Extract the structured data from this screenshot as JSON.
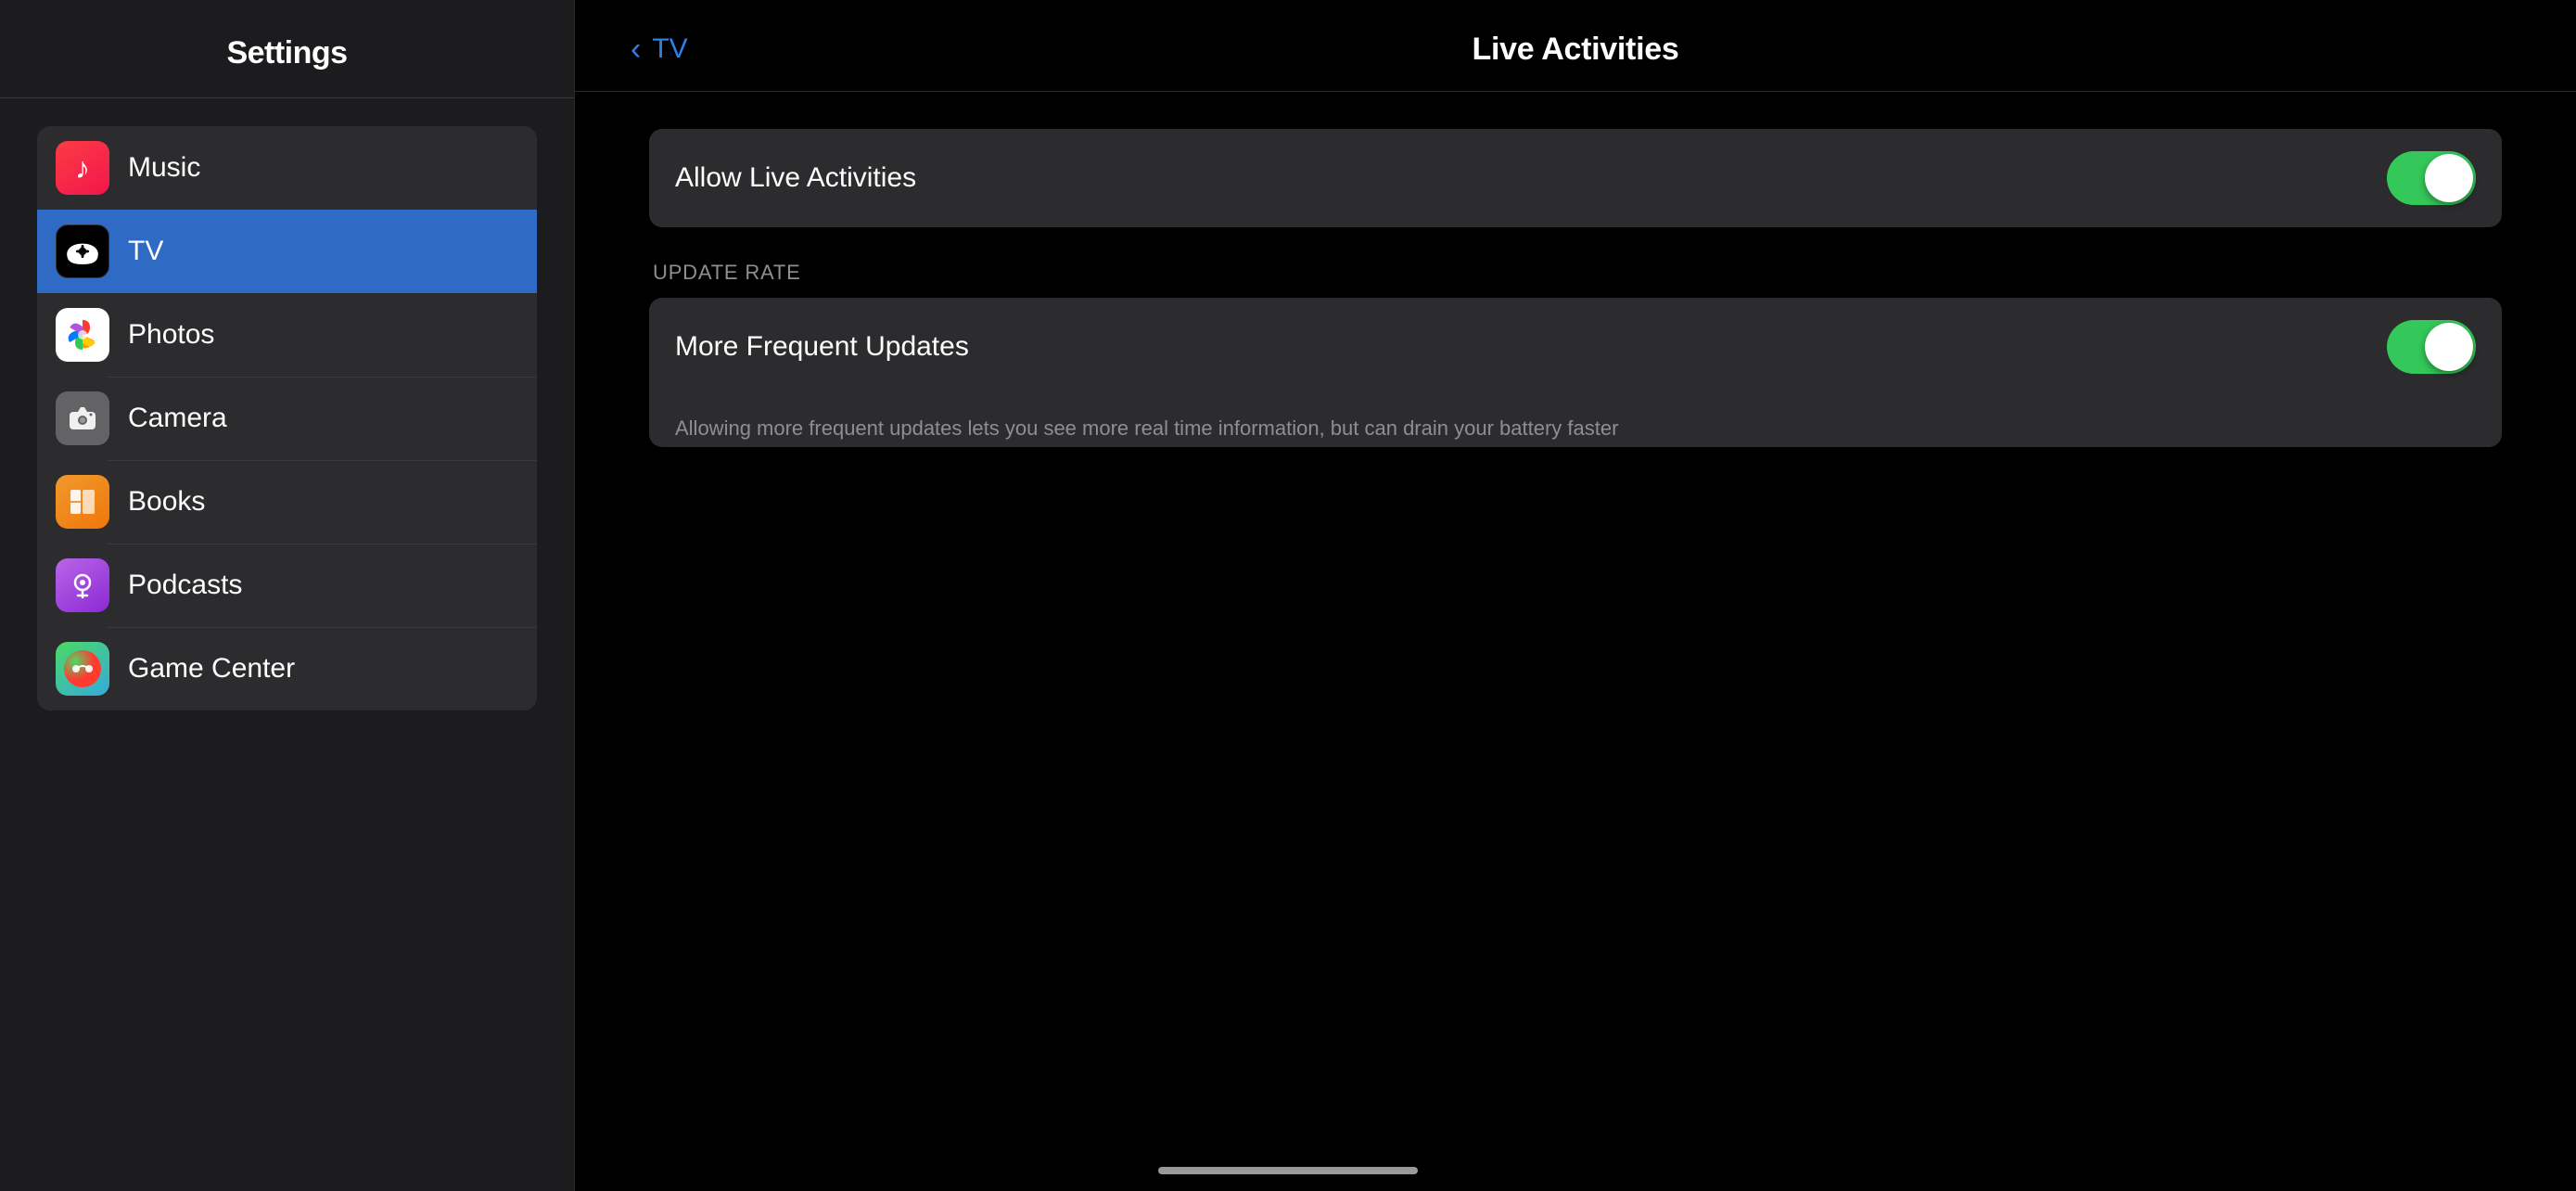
{
  "left": {
    "header": "Settings",
    "items": [
      {
        "id": "music",
        "label": "Music",
        "icon": "music",
        "active": false
      },
      {
        "id": "tv",
        "label": "TV",
        "icon": "tv",
        "active": true
      },
      {
        "id": "photos",
        "label": "Photos",
        "icon": "photos",
        "active": false
      },
      {
        "id": "camera",
        "label": "Camera",
        "icon": "camera",
        "active": false
      },
      {
        "id": "books",
        "label": "Books",
        "icon": "books",
        "active": false
      },
      {
        "id": "podcasts",
        "label": "Podcasts",
        "icon": "podcasts",
        "active": false
      },
      {
        "id": "gamecenter",
        "label": "Game Center",
        "icon": "gamecenter",
        "active": false
      }
    ]
  },
  "right": {
    "back_label": "TV",
    "title": "Live Activities",
    "allow_toggle": {
      "label": "Allow Live Activities",
      "on": true
    },
    "update_rate": {
      "section_label": "UPDATE RATE",
      "toggle": {
        "label": "More Frequent Updates",
        "on": true
      },
      "helper_text": "Allowing more frequent updates lets you see more real time information, but can drain your battery faster"
    }
  }
}
